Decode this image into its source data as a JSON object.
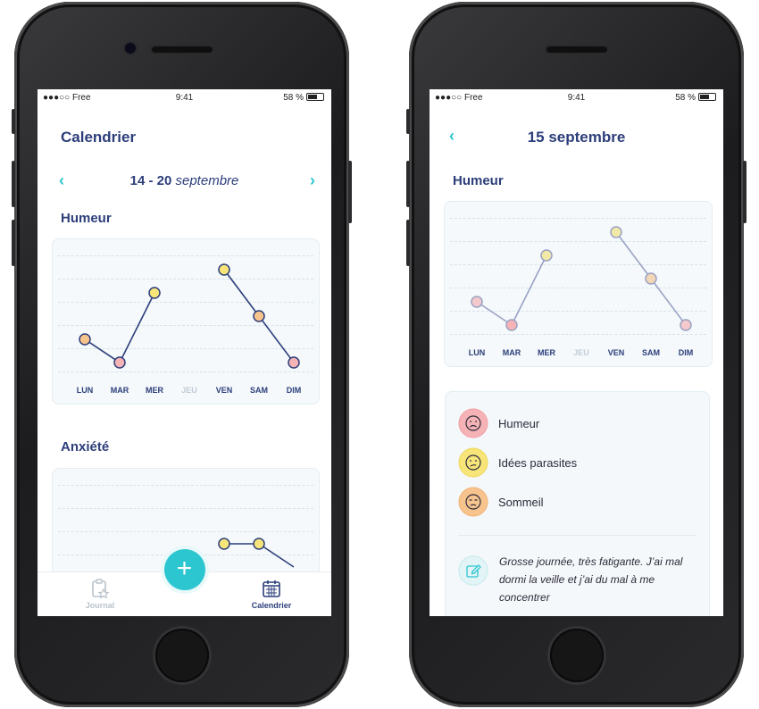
{
  "status_bar": {
    "carrier": "●●●○○ Free",
    "time": "9:41",
    "battery": "58 %"
  },
  "left_screen": {
    "title": "Calendrier",
    "week": {
      "range": "14 - 20",
      "month": "septembre"
    },
    "humeur": {
      "label": "Humeur"
    },
    "anxiete": {
      "label": "Anxiété"
    },
    "tabs": {
      "journal": "Journal",
      "calendrier": "Calendrier"
    },
    "fab_label": "+"
  },
  "right_screen": {
    "title": "15 septembre",
    "section": "Humeur",
    "legend": [
      {
        "label": "Humeur",
        "icon": "sad-face-icon",
        "color": "#f6b3b6"
      },
      {
        "label": "Idées parasites",
        "icon": "confused-face-icon",
        "color": "#f7e57a"
      },
      {
        "label": "Sommeil",
        "icon": "tired-face-icon",
        "color": "#f7c48e"
      }
    ],
    "note": "Grosse journée, très fatigante. J’ai mal dormi la veille et j’ai du mal à me concentrer"
  },
  "colors": {
    "accent": "#2cc6d1",
    "title": "#2c3e7a",
    "pink": "#f6b3b6",
    "yellow": "#f7e57a",
    "orange": "#f7c48e"
  },
  "chart_data": [
    {
      "type": "line",
      "categories": [
        "LUN",
        "MAR",
        "MER",
        "JEU",
        "VEN",
        "SAM",
        "DIM"
      ],
      "series": [
        {
          "values": [
            2,
            1,
            4,
            null,
            5,
            3,
            1
          ]
        }
      ],
      "point_colors": [
        "#f7c48e",
        "#f6b3b6",
        "#f7e57a",
        null,
        "#f7e57a",
        "#f7c48e",
        "#f6b3b6"
      ],
      "grid": true
    },
    {
      "type": "line",
      "categories": [
        "LUN",
        "MAR",
        "MER",
        "JEU",
        "VEN",
        "SAM",
        "DIM"
      ],
      "series": [
        {
          "values": [
            null,
            null,
            null,
            null,
            4,
            4,
            3
          ]
        }
      ],
      "point_colors": [
        null,
        null,
        null,
        null,
        "#f7e57a",
        "#f7e57a",
        null
      ],
      "grid": true
    },
    {
      "type": "line",
      "categories": [
        "LUN",
        "MAR",
        "MER",
        "JEU",
        "VEN",
        "SAM",
        "DIM"
      ],
      "series": [
        {
          "values": [
            2,
            1,
            4,
            null,
            5,
            3,
            1
          ]
        }
      ],
      "point_colors": [
        "#f3c9cc",
        "#f6b3b6",
        "#f2e8a8",
        null,
        "#f2e8a8",
        "#f3d7b6",
        "#f3c9cc"
      ],
      "grid": true
    }
  ]
}
